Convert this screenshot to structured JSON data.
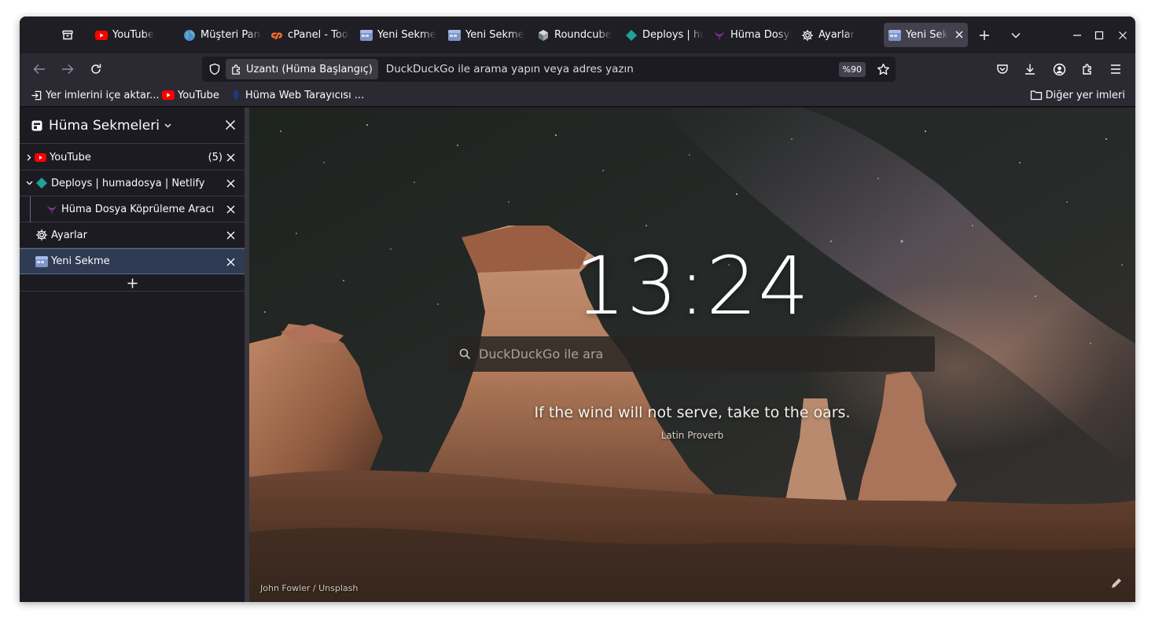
{
  "tabs": [
    {
      "label": "YouTube",
      "favicon": "youtube-icon"
    },
    {
      "label": "Müşteri Paneli",
      "favicon": "globe-icon"
    },
    {
      "label": "cPanel - Tools",
      "favicon": "cpanel-icon"
    },
    {
      "label": "Yeni Sekme",
      "favicon": "newtab-icon"
    },
    {
      "label": "Yeni Sekme",
      "favicon": "newtab-icon"
    },
    {
      "label": "Roundcube",
      "favicon": "roundcube-icon"
    },
    {
      "label": "Deploys | humadosya",
      "favicon": "netlify-icon"
    },
    {
      "label": "Hüma Dosya",
      "favicon": "huma-icon"
    },
    {
      "label": "Ayarlar",
      "favicon": "gear-icon"
    },
    {
      "label": "Yeni Sekme",
      "favicon": "newtab-icon",
      "active": true
    }
  ],
  "navbar": {
    "extension_label": "Uzantı (Hüma Başlangıç)",
    "url_placeholder": "DuckDuckGo ile arama yapın veya adres yazın",
    "zoom": "%90"
  },
  "bookmarks": {
    "import_label": "Yer imlerini içe aktar...",
    "items": [
      {
        "label": "YouTube",
        "icon": "youtube-icon"
      },
      {
        "label": "Hüma Web Tarayıcısı ...",
        "icon": "huma-web-icon"
      }
    ],
    "other_label": "Diğer yer imleri"
  },
  "sidebar": {
    "title": "Hüma Sekmeleri",
    "rows": [
      {
        "label": "YouTube",
        "count": "(5)"
      },
      {
        "label": "Deploys | humadosya | Netlify"
      },
      {
        "label": "Hüma Dosya Köprüleme Aracı"
      },
      {
        "label": "Ayarlar"
      },
      {
        "label": "Yeni Sekme"
      }
    ]
  },
  "newtab": {
    "clock": "13:24",
    "search_placeholder": "DuckDuckGo ile ara",
    "quote": "If the wind will not serve, take to the oars.",
    "quote_author": "Latin Proverb",
    "credit": "John Fowler / Unsplash"
  },
  "colors": {
    "toolbar": "#2b2a33",
    "frame": "#1f1e25",
    "sidebar_active": "#2e3b52",
    "youtube_red": "#ff0000",
    "netlify_teal": "#1fa29b"
  }
}
